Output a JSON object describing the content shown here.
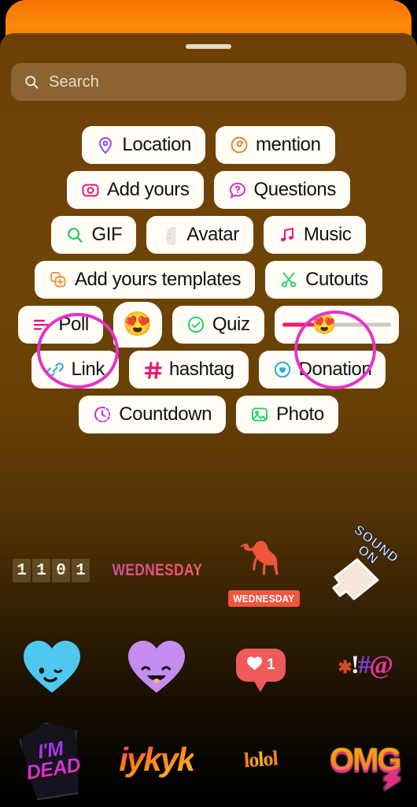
{
  "theme": {
    "story_background_top": "#f97306",
    "sheet_background_top": "#6e3f08",
    "sheet_background_bottom": "#000000",
    "pill_background": "#fffdf6",
    "pill_text": "#111111",
    "annotation_color": "#e832c8"
  },
  "search": {
    "placeholder": "Search",
    "value": "",
    "icon": "search-icon"
  },
  "sticker_rows": [
    {
      "items": [
        {
          "label": "Location",
          "icon": "location-pin-icon",
          "icon_color": "#8a4bff",
          "type": "pill"
        },
        {
          "label": "mention",
          "icon": "threads-at-icon",
          "icon_color": "#e08a2e",
          "type": "pill"
        }
      ]
    },
    {
      "items": [
        {
          "label": "Add yours",
          "icon": "camera-icon",
          "icon_color": "#e5197d",
          "type": "pill"
        },
        {
          "label": "Questions",
          "icon": "question-bubble-icon",
          "icon_color": "#cc39c4",
          "type": "pill"
        }
      ]
    },
    {
      "items": [
        {
          "label": "GIF",
          "icon": "gif-search-icon",
          "icon_color": "#1ec96a",
          "type": "pill"
        },
        {
          "label": "Avatar",
          "icon": "avatar-face-icon",
          "icon_color": "#e8e0d8",
          "type": "pill"
        },
        {
          "label": "Music",
          "icon": "music-note-icon",
          "icon_color": "#e5197d",
          "type": "pill"
        }
      ]
    },
    {
      "items": [
        {
          "label": "Add yours templates",
          "icon": "templates-icon",
          "icon_color": "#f09236",
          "type": "pill"
        },
        {
          "label": "Cutouts",
          "icon": "scissors-icon",
          "icon_color": "#2fd06f",
          "type": "pill"
        }
      ]
    },
    {
      "items": [
        {
          "label": "Poll",
          "icon": "poll-bars-icon",
          "icon_color": "#e5197d",
          "type": "pill",
          "annotated": true
        },
        {
          "label": "",
          "icon": "emoji-reaction-icon",
          "emoji": "😍",
          "type": "emoji-bubble"
        },
        {
          "label": "Quiz",
          "icon": "check-circle-icon",
          "icon_color": "#2fd06f",
          "type": "pill"
        },
        {
          "label": "",
          "icon": "emoji-slider-icon",
          "emoji": "😍",
          "type": "emoji-slider",
          "annotated": true,
          "fill_color": "#f0196e",
          "track_color": "#c9c9c9"
        }
      ]
    },
    {
      "items": [
        {
          "label": "Link",
          "icon": "link-chain-icon",
          "icon_color": "#2aa6e8",
          "type": "pill"
        },
        {
          "label": "hashtag",
          "icon": "hashtag-icon",
          "icon_color": "#e5197d",
          "type": "pill",
          "prefix": "#"
        },
        {
          "label": "Donation",
          "icon": "donation-heart-icon",
          "icon_color": "#2aa6e8",
          "type": "pill"
        }
      ]
    },
    {
      "items": [
        {
          "label": "Countdown",
          "icon": "countdown-clock-icon",
          "icon_color": "#cc39c4",
          "type": "pill"
        },
        {
          "label": "Photo",
          "icon": "photo-image-icon",
          "icon_color": "#2fd06f",
          "type": "pill"
        }
      ]
    }
  ],
  "sticker_grid": [
    {
      "cells": [
        {
          "name": "flip-counter-sticker",
          "kind": "counter",
          "digits": [
            "1",
            "1",
            "0",
            "1"
          ]
        },
        {
          "name": "wednesday-text-sticker",
          "kind": "text",
          "text": "WEDNESDAY"
        },
        {
          "name": "camel-wednesday-sticker",
          "kind": "camel",
          "text": "WEDNESDAY"
        },
        {
          "name": "sound-on-sticker",
          "kind": "sound-on",
          "line1": "SOUND",
          "line2": "ON"
        }
      ]
    },
    {
      "cells": [
        {
          "name": "blue-winking-heart-sticker",
          "kind": "heart",
          "color": "#4fc7ef",
          "face": "wink"
        },
        {
          "name": "purple-smiling-heart-sticker",
          "kind": "heart",
          "color": "#c58df0",
          "face": "smile"
        },
        {
          "name": "like-notification-sticker",
          "kind": "like",
          "count": "1"
        },
        {
          "name": "symbols-cluster-sticker",
          "kind": "symbols",
          "text": "✱!#@"
        }
      ]
    },
    {
      "cells": [
        {
          "name": "im-dead-sticker",
          "kind": "imdead",
          "line1": "I'M",
          "line2": "DEAD"
        },
        {
          "name": "iykyk-sticker",
          "kind": "iykyk",
          "text": "iykyk"
        },
        {
          "name": "lolol-sticker",
          "kind": "lolol",
          "text": "lolol"
        },
        {
          "name": "omg-sticker",
          "kind": "omg",
          "text": "OMG"
        }
      ]
    }
  ]
}
